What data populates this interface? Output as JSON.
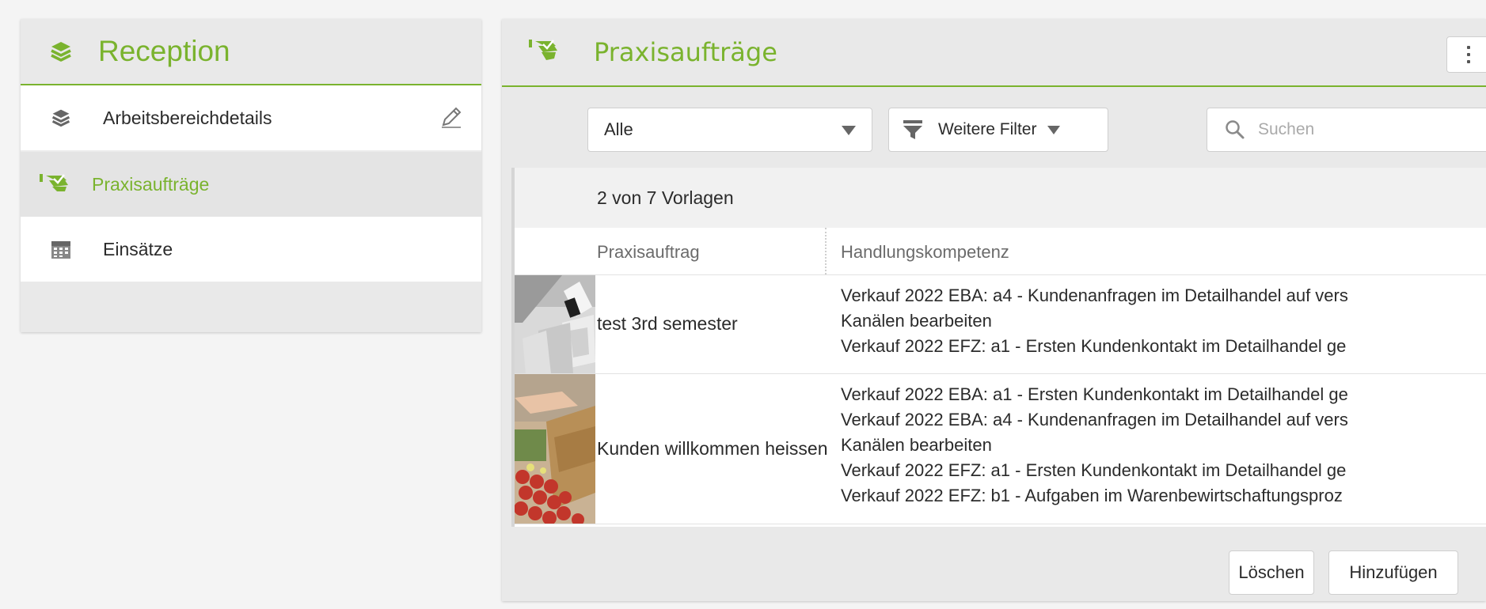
{
  "colors": {
    "accent": "#7ab32e"
  },
  "left_panel": {
    "title": "Reception",
    "icon": "layers-icon",
    "items": [
      {
        "label": "Arbeitsbereichdetails",
        "icon": "layers-icon",
        "action_icon": "pencil-icon"
      },
      {
        "label": "Praxisaufträge",
        "icon": "hand-check-icon",
        "active": true
      },
      {
        "label": "Einsätze",
        "icon": "calendar-icon"
      }
    ]
  },
  "right_panel": {
    "title": "Praxisaufträge",
    "icon": "hand-check-icon",
    "menu_icon": "kebab-menu-icon",
    "filter": {
      "select_value": "Alle",
      "more_filter_label": "Weitere Filter",
      "search_placeholder": "Suchen"
    },
    "count_text": "2 von 7 Vorlagen",
    "table": {
      "columns": [
        "Praxisauftrag",
        "Handlungskompetenz"
      ],
      "rows": [
        {
          "name": "test 3rd semester",
          "thumbnail": "desk-photo",
          "competencies": [
            "Verkauf 2022 EBA: a4 - Kundenanfragen im Detailhandel auf vers",
            "Kanälen bearbeiten",
            "Verkauf 2022 EFZ: a1 - Ersten Kundenkontakt im Detailhandel ge"
          ]
        },
        {
          "name": "Kunden willkommen heissen",
          "thumbnail": "market-photo",
          "competencies": [
            "Verkauf 2022 EBA: a1 - Ersten Kundenkontakt im Detailhandel ge",
            "Verkauf 2022 EBA: a4 - Kundenanfragen im Detailhandel auf vers",
            "Kanälen bearbeiten",
            "Verkauf 2022 EFZ: a1 - Ersten Kundenkontakt im Detailhandel ge",
            "Verkauf 2022 EFZ: b1 - Aufgaben im Warenbewirtschaftungsproz"
          ]
        }
      ]
    },
    "buttons": {
      "delete": "Löschen",
      "add": "Hinzufügen"
    }
  }
}
